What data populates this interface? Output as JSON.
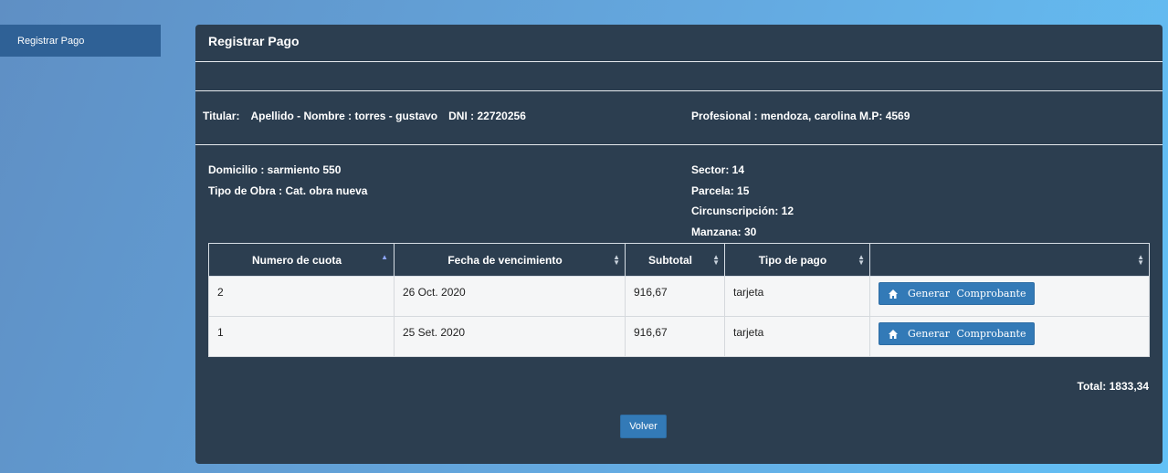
{
  "sidebar": {
    "items": [
      {
        "label": "Registrar Pago"
      }
    ]
  },
  "panel": {
    "title": "Registrar Pago"
  },
  "titular": {
    "prefix": "Titular:",
    "name": "Apellido - Nombre : torres - gustavo",
    "dni": "DNI : 22720256"
  },
  "profesional": "Profesional : mendoza, carolina M.P: 4569",
  "domicilio": "Domicilio : sarmiento 550",
  "tipo_obra": "Tipo de Obra : Cat. obra nueva",
  "sector": "Sector: 14",
  "parcela": "Parcela: 15",
  "circunscripcion": "Circunscripción: 12",
  "manzana": "Manzana: 30",
  "table": {
    "headers": [
      "Numero de cuota",
      "Fecha de vencimiento",
      "Subtotal",
      "Tipo de pago",
      ""
    ],
    "rows": [
      {
        "cuota": "2",
        "fecha": "26 Oct. 2020",
        "subtotal": "916,67",
        "tipo": "tarjeta",
        "action": "Generar Comprobante"
      },
      {
        "cuota": "1",
        "fecha": "25 Set. 2020",
        "subtotal": "916,67",
        "tipo": "tarjeta",
        "action": "Generar Comprobante"
      }
    ]
  },
  "total": "Total: 1833,34",
  "back_button": "Volver",
  "colors": {
    "panel_bg": "#2c3e50",
    "primary_button": "#337ab7",
    "sidebar_active": "#2f6196"
  },
  "icons": {
    "generar": "home-icon"
  }
}
